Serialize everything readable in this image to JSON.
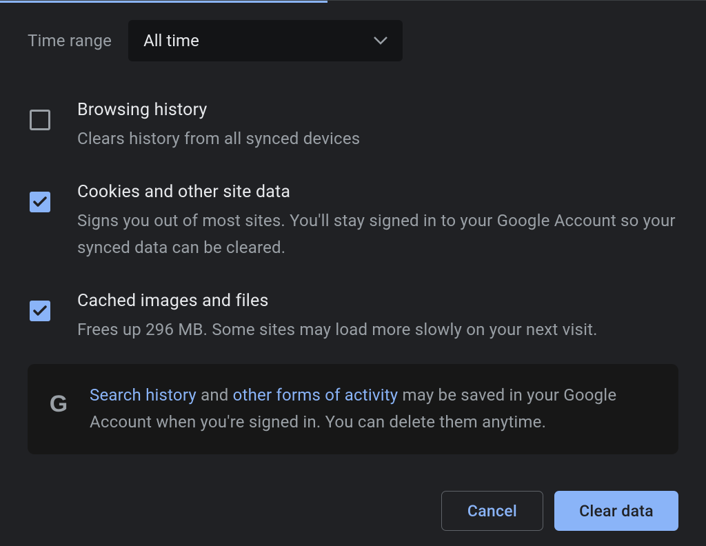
{
  "timeRange": {
    "label": "Time range",
    "value": "All time"
  },
  "options": {
    "browsingHistory": {
      "checked": false,
      "title": "Browsing history",
      "desc": "Clears history from all synced devices"
    },
    "cookies": {
      "checked": true,
      "title": "Cookies and other site data",
      "desc": "Signs you out of most sites. You'll stay signed in to your Google Account so your synced data can be cleared."
    },
    "cache": {
      "checked": true,
      "title": "Cached images and files",
      "desc": "Frees up 296 MB. Some sites may load more slowly on your next visit."
    }
  },
  "notice": {
    "link1": "Search history",
    "mid1": " and ",
    "link2": "other forms of activity",
    "mid2": " may be saved in your Google Account when you're signed in. You can delete them anytime."
  },
  "buttons": {
    "cancel": "Cancel",
    "clear": "Clear data"
  }
}
